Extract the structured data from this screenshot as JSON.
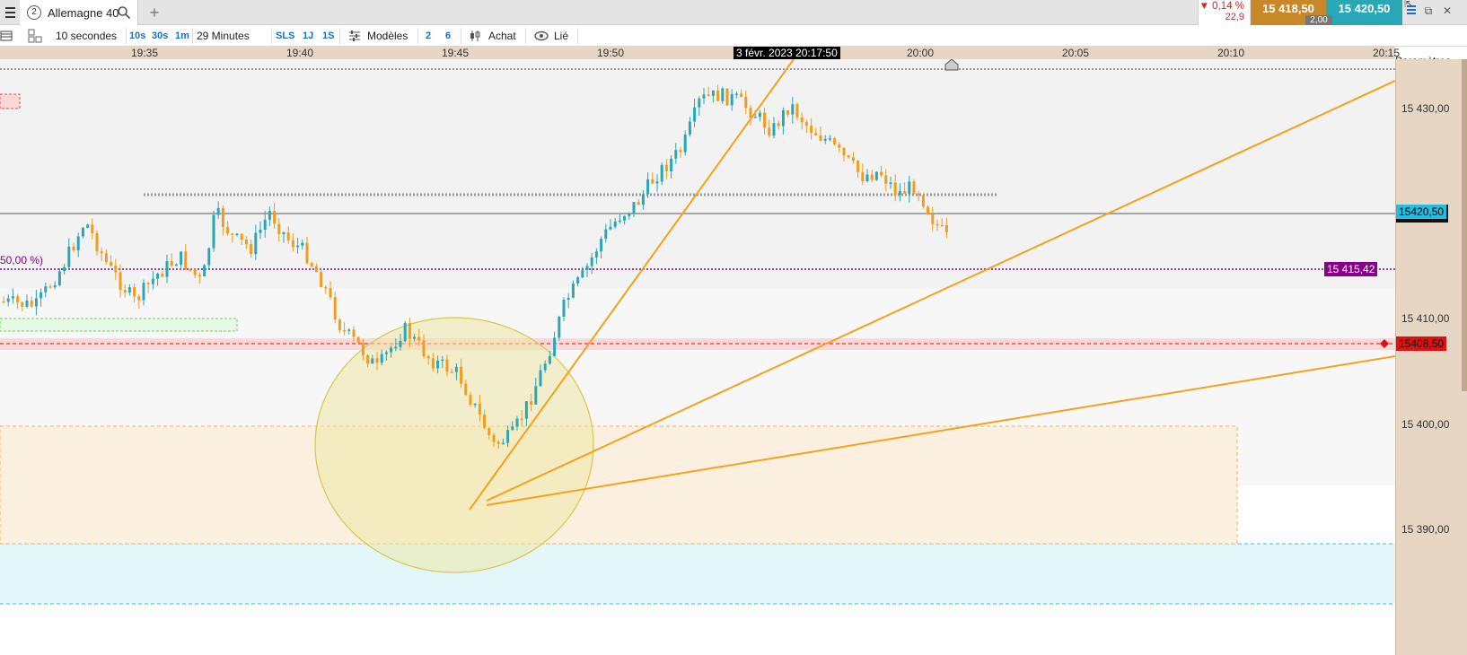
{
  "tab": {
    "index": "2",
    "title": "Allemagne 40",
    "add": "+"
  },
  "quote": {
    "change_pct": "▼ 0,14 %",
    "change_pts": "22,9",
    "bid": "15 418,50",
    "ask": "15 420,50",
    "spread": "2,00"
  },
  "window": {
    "pin": "⇱",
    "popout": "⧉",
    "close": "✕"
  },
  "toolbar": {
    "interval": "10 secondes",
    "quick_10s": "10s",
    "quick_30s": "30s",
    "quick_1m": "1m",
    "duration": "29 Minutes",
    "sls": "SLS",
    "q1j": "1J",
    "q1s": "1S",
    "models": "Modèles",
    "n2": "2",
    "n6": "6",
    "buy": "Achat",
    "linked": "Lié",
    "settings": "Paramètres"
  },
  "time_axis": {
    "labels": [
      "19:35",
      "19:40",
      "19:45",
      "19:50",
      "20:00",
      "20:05",
      "20:10",
      "20:15"
    ],
    "cursor": "3 févr. 2023 20:17:50"
  },
  "price_axis": {
    "labels": [
      "15 430,00",
      "15 410,00",
      "15 400,00",
      "15 390,00"
    ],
    "tag_last": "15420,50",
    "tag_fib": "15 415,42",
    "tag_alert": "15408,50"
  },
  "annotations": {
    "fib_label": "50,00 %)"
  },
  "colors": {
    "up": "#2aa7b7",
    "down": "#f29b1d",
    "trendline": "#f5a21b",
    "fib": "#880088",
    "alert": "#e01010",
    "axis_bg": "#e6d6c3"
  }
}
